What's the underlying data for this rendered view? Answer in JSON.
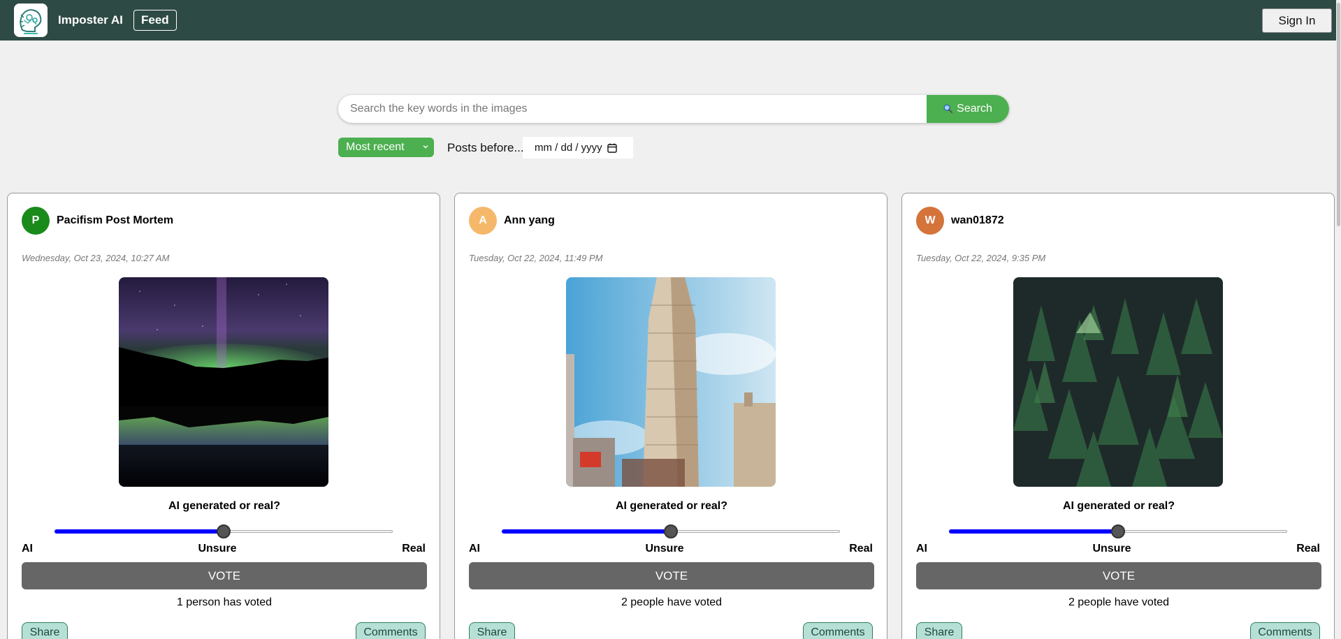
{
  "header": {
    "brand": "Imposter AI",
    "feed_label": "Feed",
    "signin_label": "Sign In",
    "background": "#2e4a44"
  },
  "search": {
    "placeholder": "Search the key words in the images",
    "button_label": "Search",
    "button_icon": "search-icon"
  },
  "filters": {
    "sort_selected": "Most recent",
    "posts_before_label": "Posts before...",
    "date_placeholder": "mm / dd / yyyy"
  },
  "posts": [
    {
      "avatar_letter": "P",
      "avatar_color": "#1a8a1a",
      "username": "Pacifism Post Mortem",
      "timestamp": "Wednesday, Oct 23, 2024, 10:27 AM",
      "image": "aurora-over-lake",
      "question": "AI generated or real?",
      "slider_value": 0.5,
      "label_ai": "AI",
      "label_unsure": "Unsure",
      "label_real": "Real",
      "vote_label": "VOTE",
      "vote_count": "1 person has voted",
      "share_label": "Share",
      "comments_label": "Comments"
    },
    {
      "avatar_letter": "A",
      "avatar_color": "#f5b86a",
      "username": "Ann yang",
      "timestamp": "Tuesday, Oct 22, 2024, 11:49 PM",
      "image": "flatiron-building",
      "question": "AI generated or real?",
      "slider_value": 0.5,
      "label_ai": "AI",
      "label_unsure": "Unsure",
      "label_real": "Real",
      "vote_label": "VOTE",
      "vote_count": "2 people have voted",
      "share_label": "Share",
      "comments_label": "Comments"
    },
    {
      "avatar_letter": "W",
      "avatar_color": "#d4733a",
      "username": "wan01872",
      "timestamp": "Tuesday, Oct 22, 2024, 9:35 PM",
      "image": "pine-forest",
      "question": "AI generated or real?",
      "slider_value": 0.5,
      "label_ai": "AI",
      "label_unsure": "Unsure",
      "label_real": "Real",
      "vote_label": "VOTE",
      "vote_count": "2 people have voted",
      "share_label": "Share",
      "comments_label": "Comments"
    }
  ]
}
